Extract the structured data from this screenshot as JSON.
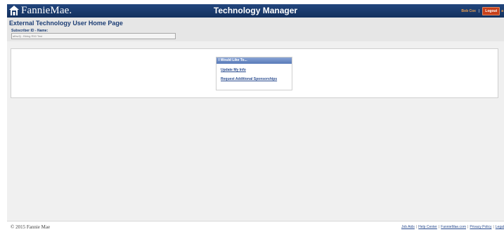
{
  "header": {
    "logo_text": "FannieMae.",
    "app_title": "Technology Manager",
    "user_name": "Bob Cox",
    "user_separator": "|",
    "logout_label": "Logout",
    "edge_glyph": "a"
  },
  "title_strip": {
    "page_title": "External Technology User Home Page",
    "subscriber_label": "Subscriber ID - Name:",
    "subscriber_value": "afbw3j - Bldng R50 Test"
  },
  "actions": {
    "header": "I Would Like To...",
    "items": [
      {
        "label": "Update My Info"
      },
      {
        "label": "Request Additional Sponsorships"
      }
    ]
  },
  "footer": {
    "copyright": "© 2015 Fannie Mae",
    "links": [
      {
        "label": "Job Aids"
      },
      {
        "label": "Help Center"
      },
      {
        "label": "FannieMae.com"
      },
      {
        "label": "Privacy Policy"
      },
      {
        "label": "Legal"
      }
    ],
    "separator": "|"
  },
  "colors": {
    "header_bg": "#1a3a6b",
    "title_text": "#1d3e75",
    "logout_bg": "#c8401a",
    "user_name": "#f2a04a",
    "action_header_bg": "#6f8ec7",
    "link": "#2a4c8f"
  },
  "icons": {
    "logo": "fannie-mae-house-logo-icon"
  }
}
